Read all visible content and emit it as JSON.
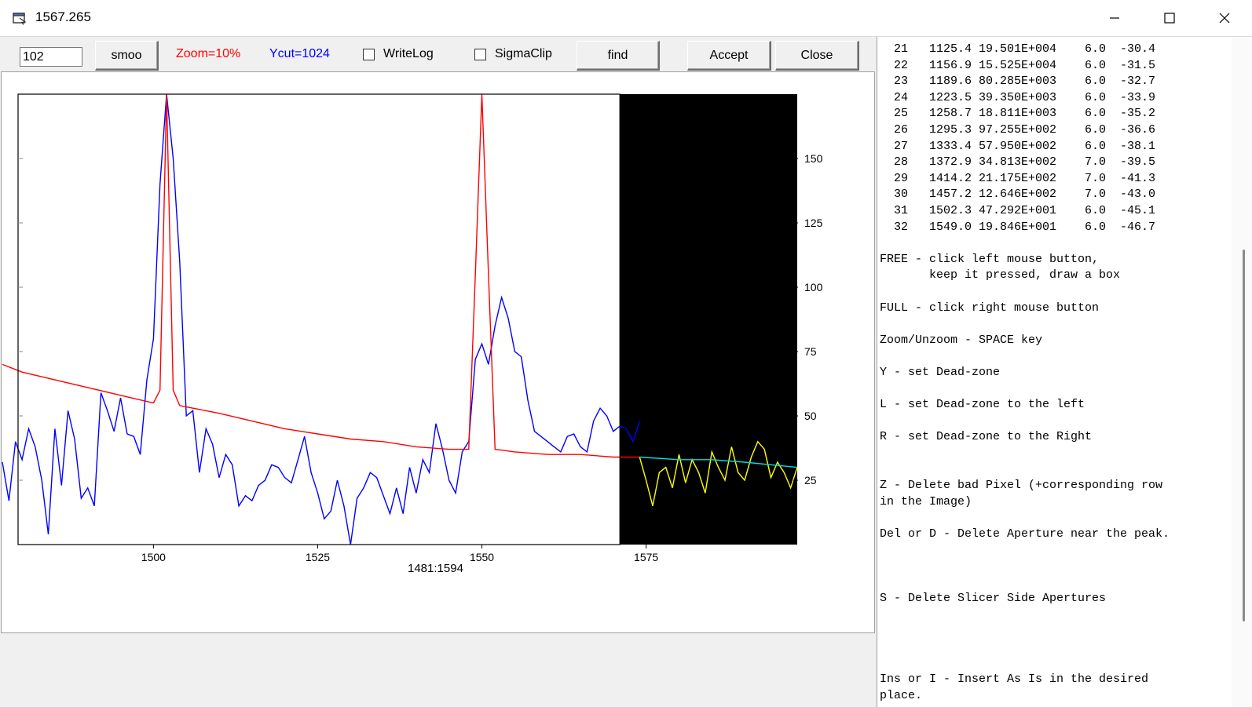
{
  "window": {
    "title": "1567.265"
  },
  "toolbar": {
    "input_value": "102",
    "smoo_label": "smoo",
    "zoom_label": "Zoom=10%",
    "ycut_label": "Ycut=1024",
    "writelog_label": "WriteLog",
    "sigmaclip_label": "SigmaClip",
    "find_label": "find",
    "accept_label": "Accept",
    "close_label": "Close",
    "zoom_color": "#ff0000",
    "ycut_color": "#0000ff"
  },
  "plot": {
    "range_label": "1481:1594"
  },
  "chart_data": {
    "type": "line",
    "x_range": [
      1477,
      1598
    ],
    "y_range": [
      0,
      175
    ],
    "right_axis_ticks": [
      "25",
      "50",
      "75",
      "100",
      "125",
      "150"
    ],
    "x_ticks": [
      "1500",
      "1525",
      "1550",
      "1575"
    ],
    "dead_zone_start": 1571,
    "series": [
      {
        "color": "#0000ff",
        "points": [
          [
            1477,
            32
          ],
          [
            1478,
            17
          ],
          [
            1479,
            40
          ],
          [
            1480,
            33
          ],
          [
            1481,
            45
          ],
          [
            1482,
            38
          ],
          [
            1483,
            25
          ],
          [
            1484,
            4
          ],
          [
            1485,
            45
          ],
          [
            1486,
            23
          ],
          [
            1487,
            52
          ],
          [
            1488,
            41
          ],
          [
            1489,
            18
          ],
          [
            1490,
            22
          ],
          [
            1491,
            15
          ],
          [
            1492,
            59
          ],
          [
            1493,
            52
          ],
          [
            1494,
            44
          ],
          [
            1495,
            57
          ],
          [
            1496,
            43
          ],
          [
            1497,
            42
          ],
          [
            1498,
            35
          ],
          [
            1499,
            64
          ],
          [
            1500,
            80
          ],
          [
            1501,
            140
          ],
          [
            1502,
            175
          ],
          [
            1503,
            150
          ],
          [
            1504,
            110
          ],
          [
            1505,
            50
          ],
          [
            1506,
            52
          ],
          [
            1507,
            28
          ],
          [
            1508,
            45
          ],
          [
            1509,
            39
          ],
          [
            1510,
            26
          ],
          [
            1511,
            35
          ],
          [
            1512,
            31
          ],
          [
            1513,
            15
          ],
          [
            1514,
            19
          ],
          [
            1515,
            17
          ],
          [
            1516,
            23
          ],
          [
            1517,
            25
          ],
          [
            1518,
            31
          ],
          [
            1519,
            30
          ],
          [
            1520,
            26
          ],
          [
            1521,
            24
          ],
          [
            1522,
            33
          ],
          [
            1523,
            42
          ],
          [
            1524,
            28
          ],
          [
            1525,
            20
          ],
          [
            1526,
            10
          ],
          [
            1527,
            13
          ],
          [
            1528,
            25
          ],
          [
            1529,
            15
          ],
          [
            1530,
            0
          ],
          [
            1531,
            18
          ],
          [
            1532,
            22
          ],
          [
            1533,
            28
          ],
          [
            1534,
            26
          ],
          [
            1535,
            19
          ],
          [
            1536,
            12
          ],
          [
            1537,
            22
          ],
          [
            1538,
            12
          ],
          [
            1539,
            30
          ],
          [
            1540,
            20
          ],
          [
            1541,
            33
          ],
          [
            1542,
            28
          ],
          [
            1543,
            47
          ],
          [
            1544,
            37
          ],
          [
            1545,
            25
          ],
          [
            1546,
            20
          ],
          [
            1547,
            36
          ],
          [
            1548,
            40
          ],
          [
            1549,
            72
          ],
          [
            1550,
            78
          ],
          [
            1551,
            70
          ],
          [
            1552,
            85
          ],
          [
            1553,
            96
          ],
          [
            1554,
            88
          ],
          [
            1555,
            75
          ],
          [
            1556,
            73
          ],
          [
            1557,
            56
          ],
          [
            1558,
            44
          ],
          [
            1559,
            42
          ],
          [
            1560,
            40
          ],
          [
            1561,
            38
          ],
          [
            1562,
            36
          ],
          [
            1563,
            42
          ],
          [
            1564,
            43
          ],
          [
            1565,
            38
          ],
          [
            1566,
            36
          ],
          [
            1567,
            48
          ],
          [
            1568,
            53
          ],
          [
            1569,
            50
          ],
          [
            1570,
            44
          ],
          [
            1571,
            46
          ],
          [
            1572,
            45
          ],
          [
            1573,
            40
          ],
          [
            1574,
            48
          ]
        ]
      },
      {
        "color": "#ff0000",
        "points": [
          [
            1477,
            70
          ],
          [
            1480,
            67
          ],
          [
            1485,
            64
          ],
          [
            1490,
            61
          ],
          [
            1495,
            58
          ],
          [
            1500,
            55
          ],
          [
            1501,
            60
          ],
          [
            1502,
            175
          ],
          [
            1503,
            60
          ],
          [
            1504,
            54
          ],
          [
            1510,
            51
          ],
          [
            1515,
            48
          ],
          [
            1520,
            45
          ],
          [
            1525,
            43
          ],
          [
            1530,
            41
          ],
          [
            1535,
            40
          ],
          [
            1540,
            38
          ],
          [
            1545,
            37
          ],
          [
            1548,
            37
          ],
          [
            1549,
            105
          ],
          [
            1550,
            175
          ],
          [
            1551,
            105
          ],
          [
            1552,
            37
          ],
          [
            1555,
            36
          ],
          [
            1560,
            35
          ],
          [
            1565,
            35
          ],
          [
            1570,
            34
          ],
          [
            1574,
            34
          ]
        ]
      },
      {
        "color": "#ffff00",
        "points": [
          [
            1574,
            34
          ],
          [
            1575,
            25
          ],
          [
            1576,
            15
          ],
          [
            1577,
            28
          ],
          [
            1578,
            30
          ],
          [
            1579,
            22
          ],
          [
            1580,
            35
          ],
          [
            1581,
            24
          ],
          [
            1582,
            33
          ],
          [
            1583,
            28
          ],
          [
            1584,
            20
          ],
          [
            1585,
            36
          ],
          [
            1586,
            30
          ],
          [
            1587,
            25
          ],
          [
            1588,
            38
          ],
          [
            1589,
            28
          ],
          [
            1590,
            25
          ],
          [
            1591,
            34
          ],
          [
            1592,
            40
          ],
          [
            1593,
            37
          ],
          [
            1594,
            26
          ],
          [
            1595,
            32
          ],
          [
            1596,
            28
          ],
          [
            1597,
            22
          ],
          [
            1598,
            30
          ]
        ]
      },
      {
        "color": "#00e0e0",
        "points": [
          [
            1574,
            34
          ],
          [
            1580,
            33
          ],
          [
            1585,
            33
          ],
          [
            1590,
            32
          ],
          [
            1594,
            31
          ],
          [
            1598,
            30
          ]
        ]
      }
    ]
  },
  "aperture_rows": [
    " 21   1125.4 19.501E+004    6.0  -30.4",
    " 22   1156.9 15.525E+004    6.0  -31.5",
    " 23   1189.6 80.285E+003    6.0  -32.7",
    " 24   1223.5 39.350E+003    6.0  -33.9",
    " 25   1258.7 18.811E+003    6.0  -35.2",
    " 26   1295.3 97.255E+002    6.0  -36.6",
    " 27   1333.4 57.950E+002    6.0  -38.1",
    " 28   1372.9 34.813E+002    7.0  -39.5",
    " 29   1414.2 21.175E+002    7.0  -41.3",
    " 30   1457.2 12.646E+002    7.0  -43.0",
    " 31   1502.3 47.292E+001    6.0  -45.1",
    " 32   1549.0 19.846E+001    6.0  -46.7"
  ],
  "help_text": "\nFREE - click left mouse button,\n       keep it pressed, draw a box\n\nFULL - click right mouse button\n\nZoom/Unzoom - SPACE key\n\nY - set Dead-zone\n\nL - set Dead-zone to the left\n\nR - set Dead-zone to the Right\n\n\nZ - Delete bad Pixel (+corresponding row\nin the Image)\n\nDel or D - Delete Aperture near the peak.\n\n\n\nS - Delete Slicer Side Apertures\n\n\n\n\nIns or I - Insert As Is in the desired\nplace."
}
